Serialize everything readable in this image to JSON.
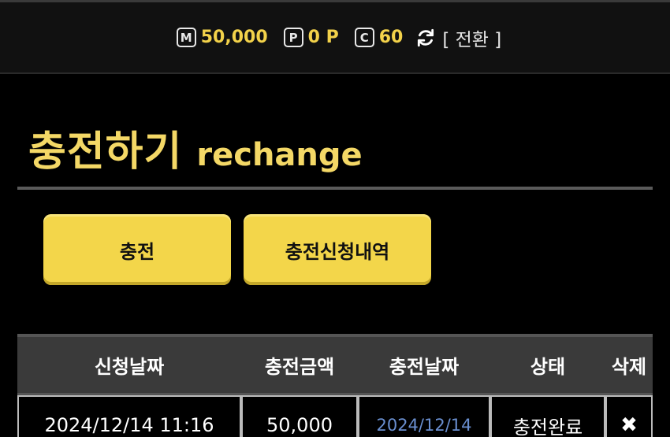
{
  "header": {
    "wallets": [
      {
        "badge": "M",
        "amount": "50,000",
        "name": "money"
      },
      {
        "badge": "P",
        "amount": "0 P",
        "name": "point"
      },
      {
        "badge": "C",
        "amount": "60",
        "name": "coin"
      }
    ],
    "convert_label": "[ 전환 ]"
  },
  "page": {
    "title_ko": "충전하기",
    "title_en": "rechange"
  },
  "buttons": {
    "charge": "충전",
    "history": "충전신청내역"
  },
  "table": {
    "headers": [
      "신청날짜",
      "충전금액",
      "충전날짜",
      "상태",
      "삭제"
    ],
    "rows": [
      {
        "request_date": "2024/12/14 11:16",
        "amount": "50,000",
        "charge_date": "2024/12/14",
        "status": "충전완료",
        "delete": "✖"
      }
    ]
  },
  "colors": {
    "accent_yellow": "#f3d64a",
    "title_yellow": "#f4d866",
    "link_blue": "#6a8fd0"
  }
}
